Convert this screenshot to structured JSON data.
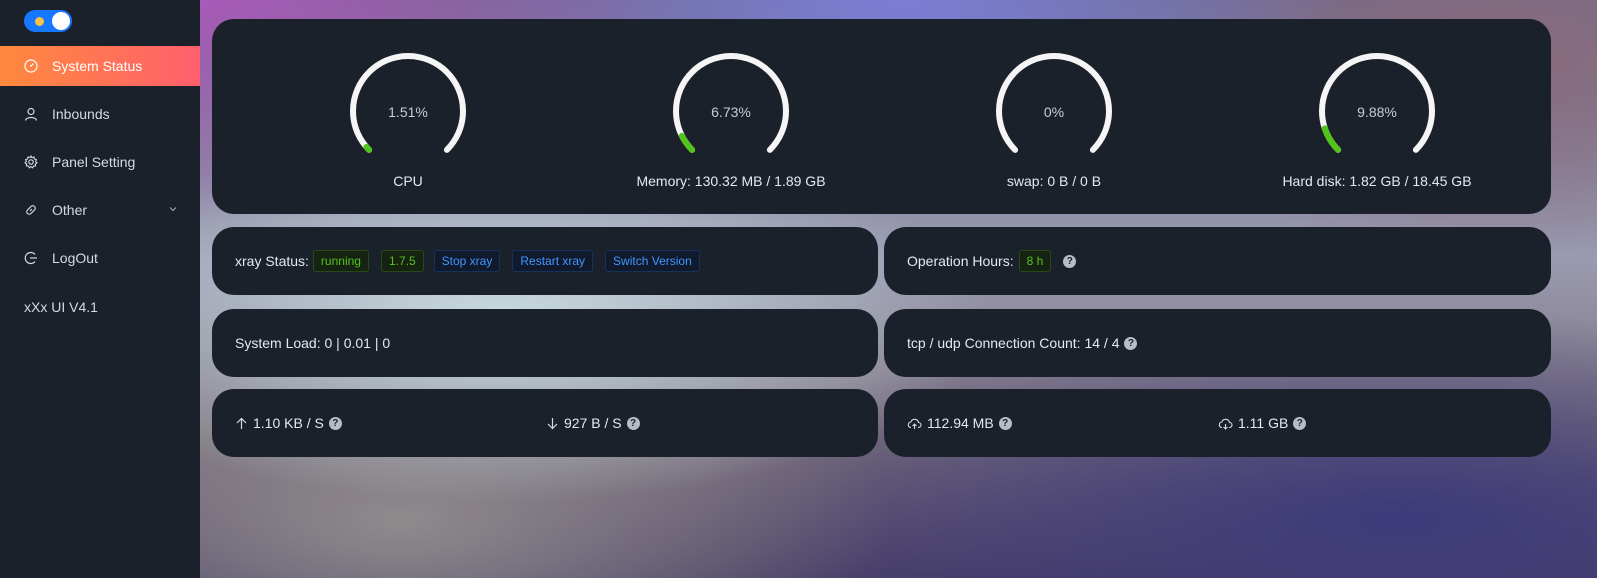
{
  "sidebar": {
    "theme_toggle": "dark-mode",
    "items": [
      {
        "label": "System Status",
        "icon": "dashboard-icon",
        "active": true
      },
      {
        "label": "Inbounds",
        "icon": "user-icon"
      },
      {
        "label": "Panel Setting",
        "icon": "gear-icon"
      },
      {
        "label": "Other",
        "icon": "link-icon"
      },
      {
        "label": "LogOut",
        "icon": "logout-icon"
      }
    ],
    "version": "xXx UI V4.1"
  },
  "gauges": [
    {
      "value": "1.51%",
      "label": "CPU",
      "percent": 1.51
    },
    {
      "value": "6.73%",
      "label": "Memory: 130.32 MB / 1.89 GB",
      "percent": 6.73
    },
    {
      "value": "0%",
      "label": "swap: 0 B / 0 B",
      "percent": 0
    },
    {
      "value": "9.88%",
      "label": "Hard disk: 1.82 GB / 18.45 GB",
      "percent": 9.88
    }
  ],
  "xray": {
    "label": "xray Status:",
    "status": "running",
    "version": "1.7.5",
    "stop": "Stop xray",
    "restart": "Restart xray",
    "switch": "Switch Version"
  },
  "operation": {
    "label": "Operation Hours:",
    "value": "8 h"
  },
  "system_load": "System Load: 0 | 0.01 | 0",
  "connections": "tcp / udp Connection Count: 14 / 4",
  "network": {
    "up_speed": "1.10 KB / S",
    "down_speed": "927 B / S",
    "total_up": "112.94 MB",
    "total_down": "1.11 GB"
  },
  "colors": {
    "accent_start": "#ff8a3d",
    "accent_end": "#ff5f6d",
    "gauge_fill": "#52c41a",
    "gauge_track": "#f5f5f5",
    "card_bg": "#1b212b"
  }
}
